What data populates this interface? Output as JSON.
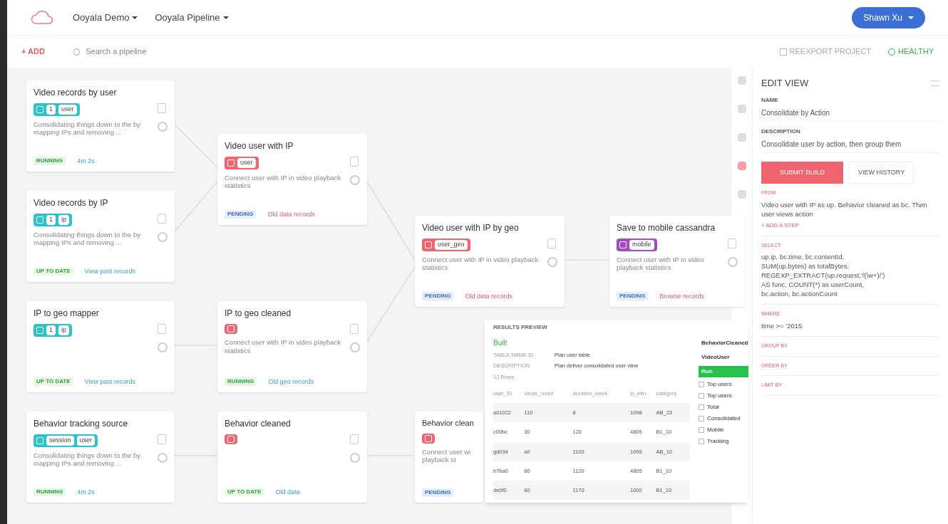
{
  "header": {
    "menus": [
      "Ooyala Demo",
      "Ooyala Pipeline"
    ],
    "user": "Shawn Xu"
  },
  "toolbar": {
    "add": "+ ADD",
    "search_placeholder": "Search a pipeline",
    "reexport": "REEXPORT PROJECT",
    "health": "HEALTHY"
  },
  "nodes": [
    {
      "title": "Video records by user",
      "color": "#2cc4c9",
      "chips": [
        "1",
        "user"
      ],
      "description": "Consolidating things down to the by mapping IPs and removing ...",
      "status": "RUNNING",
      "kind": "running",
      "link": "4m 2s"
    },
    {
      "title": "Video records by IP",
      "color": "#2cc4c9",
      "chips": [
        "1",
        "ip"
      ],
      "description": "Consolidating things down to the by mapping IPs and removing ...",
      "status": "UP TO DATE",
      "kind": "done",
      "link": "View past records"
    },
    {
      "title": "IP to geo mapper",
      "color": "#2cc4c9",
      "chips": [
        "1",
        "ip"
      ],
      "status": "UP TO DATE",
      "kind": "done",
      "link": "View past records"
    },
    {
      "title": "Behavior tracking source",
      "color": "#2cc4c9",
      "chips": [
        "session",
        "user"
      ],
      "description": "Consolidating things down to the by mapping IPs and removing ...",
      "status": "RUNNING",
      "kind": "running",
      "link": "4m 2s"
    },
    {
      "title": "Video user with IP",
      "color": "#f06470",
      "chips": [
        "user"
      ],
      "description": "Connect user with IP in video playback statistics",
      "status": "PENDING",
      "kind": "pending",
      "link": "Old data records"
    },
    {
      "title": "IP to geo cleaned",
      "color": "#f06470",
      "description": "Connect user with IP in video playback statistics",
      "status": "RUNNING",
      "kind": "running",
      "link": "Old geo records"
    },
    {
      "title": "Behavior cleaned",
      "color": "#f06470",
      "status": "UP TO DATE",
      "kind": "done",
      "link": "Old data"
    },
    {
      "title": "Video user with IP by geo",
      "color": "#f06470",
      "chips": [
        "user_geo"
      ],
      "description": "Connect user with IP in video playback statistics",
      "status": "PENDING",
      "kind": "pending",
      "link": "Old data records"
    },
    {
      "title": "Save to mobile cassandra",
      "color": "#a54bc4",
      "chips": [
        "mobile"
      ],
      "description": "Connect user with IP in video playback statistics",
      "status": "PENDING",
      "kind": "pending",
      "link": "Browse records"
    },
    {
      "title": "Behavior clean",
      "color": "#f06470",
      "description": "Connect user wi playback st",
      "status": "PENDING",
      "kind": "pending",
      "clipped": true
    }
  ],
  "preview": {
    "tab": "RESULTS PREVIEW",
    "state": "Built",
    "meta": [
      {
        "key": "TABLE NAME ID",
        "value": "Plan user table"
      },
      {
        "key": "DESCRIPTION",
        "value": "Plan deliver consolidated user view"
      }
    ],
    "count": "12 Rows",
    "columns": [
      "user_ID",
      "views_count",
      "duration_week",
      "ip_info",
      "category"
    ],
    "rows": [
      [
        "a01022",
        "110",
        "8",
        "1098",
        "AB_23"
      ],
      [
        "c00bc",
        "30",
        "120",
        "4805",
        "B1_10"
      ],
      [
        "gd034",
        "a0",
        "1100",
        "1098",
        "AB_10"
      ],
      [
        "b7ba0",
        "80",
        "1120",
        "4805",
        "B1_10"
      ],
      [
        "de0f0",
        "80",
        "1170",
        "1000",
        "B1_10"
      ]
    ],
    "sources": [
      {
        "label": "BehaviorCleaned",
        "selected": false,
        "kind": "title"
      },
      {
        "label": "VideoUser",
        "selected": false,
        "kind": "title"
      },
      {
        "label": "Run",
        "selected": true,
        "kind": "title"
      },
      {
        "label": "Top users",
        "selected": false,
        "kind": "check"
      },
      {
        "label": "Top users",
        "selected": false,
        "kind": "check"
      },
      {
        "label": "Total",
        "selected": false,
        "kind": "check"
      },
      {
        "label": "Consolidated",
        "selected": false,
        "kind": "check"
      },
      {
        "label": "Mobile",
        "selected": false,
        "kind": "check"
      },
      {
        "label": "Tracking",
        "selected": false,
        "kind": "check"
      }
    ]
  },
  "panel": {
    "title": "EDIT VIEW",
    "fields": [
      {
        "label": "NAME",
        "value": "Consolidate by Action"
      },
      {
        "label": "DESCRIPTION",
        "value": "Consolidate user by action, then group them"
      }
    ],
    "submit": "SUBMIT BUILD",
    "history": "VIEW HISTORY",
    "sections": [
      {
        "label": "FROM",
        "text": "Video user with IP as up. Behavior cleaned as bc. Then user views action",
        "link": "+ ADD A STEP"
      },
      {
        "label": "SELECT",
        "text": "up.ip, bc.time, bc.contentId,\nSUM(up.bytes) as totalBytes,\nREGEXP_EXTRACT(up.request,'/(\\w+)/')\nAS func, COUNT(*) as userCount,\nbc.action, bc.actionCount"
      },
      {
        "label": "WHERE",
        "text": "time >= '2015"
      },
      {
        "label": "GROUP BY"
      },
      {
        "label": "ORDER BY"
      },
      {
        "label": "LIMIT BY"
      }
    ]
  }
}
